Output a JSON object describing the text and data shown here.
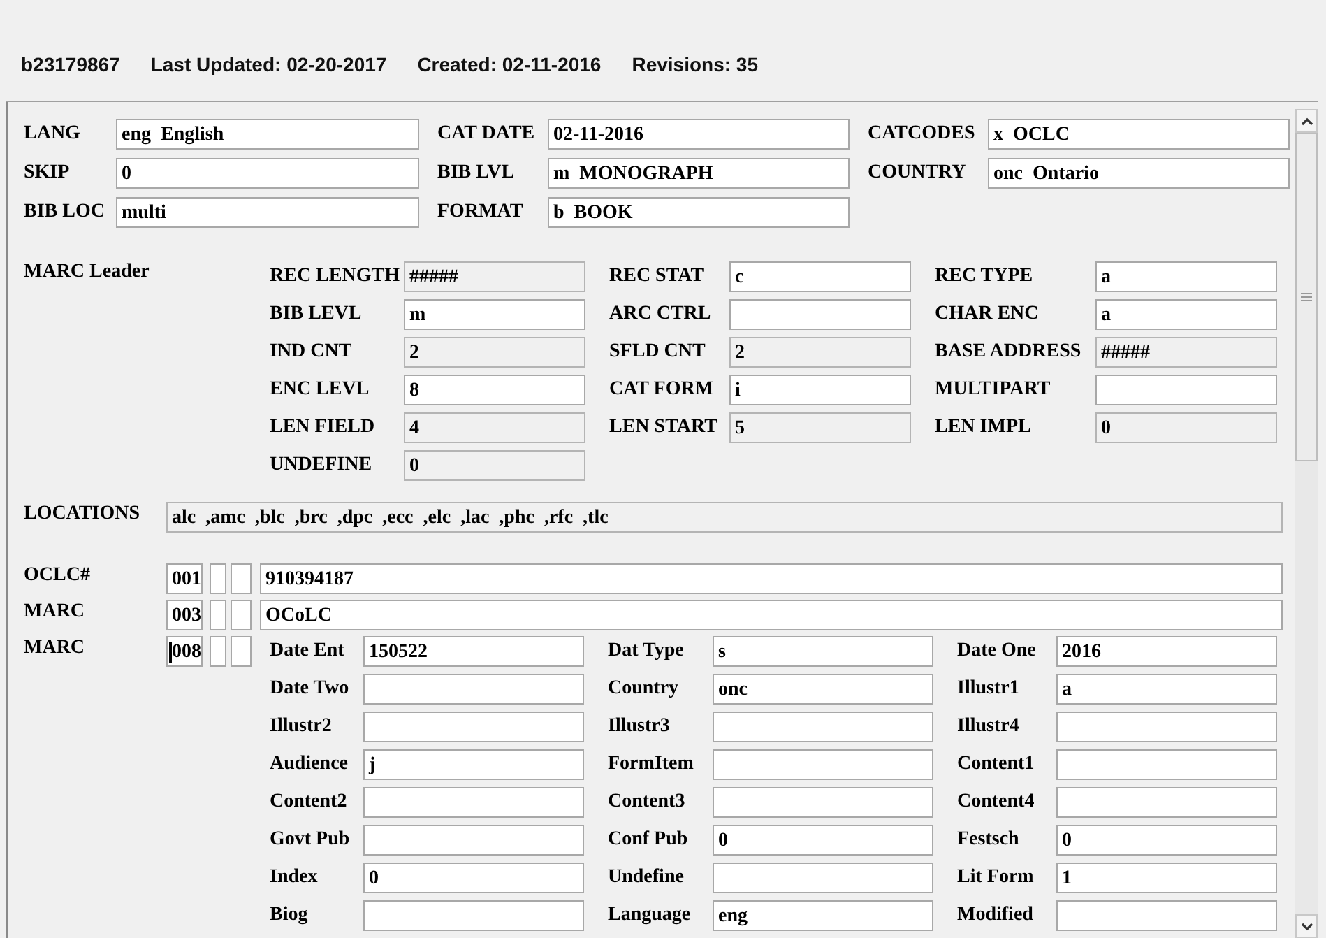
{
  "header": {
    "record_id": "b23179867",
    "last_updated": "Last Updated: 02-20-2017",
    "created": "Created: 02-11-2016",
    "revisions": "Revisions: 35"
  },
  "fixed_fields": [
    {
      "label": "LANG",
      "value": "eng  English"
    },
    {
      "label": "CAT DATE",
      "value": "02-11-2016"
    },
    {
      "label": "CATCODES",
      "value": "x  OCLC"
    },
    {
      "label": "SKIP",
      "value": "0"
    },
    {
      "label": "BIB LVL",
      "value": "m  MONOGRAPH"
    },
    {
      "label": "COUNTRY",
      "value": "onc  Ontario"
    },
    {
      "label": "BIB LOC",
      "value": "multi"
    },
    {
      "label": "FORMAT",
      "value": "b  BOOK"
    }
  ],
  "marc_leader": {
    "title": "MARC Leader",
    "fields": [
      {
        "label": "REC LENGTH",
        "value": "#####",
        "readonly": true
      },
      {
        "label": "REC STAT",
        "value": "c",
        "readonly": false
      },
      {
        "label": "REC TYPE",
        "value": "a",
        "readonly": false
      },
      {
        "label": "BIB LEVL",
        "value": "m",
        "readonly": false
      },
      {
        "label": "ARC CTRL",
        "readonly": false
      },
      {
        "label": "CHAR ENC",
        "value": "a",
        "readonly": false
      },
      {
        "label": "IND CNT",
        "value": "2",
        "readonly": true
      },
      {
        "label": "SFLD CNT",
        "value": "2",
        "readonly": true
      },
      {
        "label": "BASE ADDRESS",
        "value": "#####",
        "readonly": true
      },
      {
        "label": "ENC LEVL",
        "value": "8",
        "readonly": false
      },
      {
        "label": "CAT FORM",
        "value": "i",
        "readonly": false
      },
      {
        "label": "MULTIPART",
        "readonly": false
      },
      {
        "label": "LEN FIELD",
        "value": "4",
        "readonly": true
      },
      {
        "label": "LEN START",
        "value": "5",
        "readonly": true
      },
      {
        "label": "LEN IMPL",
        "value": "0",
        "readonly": true
      },
      {
        "label": "UNDEFINE",
        "value": "0",
        "readonly": true
      }
    ]
  },
  "locations": {
    "label": "LOCATIONS",
    "value": "alc  ,amc  ,blc  ,brc  ,dpc  ,ecc  ,elc  ,lac  ,phc  ,rfc  ,tlc"
  },
  "variable_fields": [
    {
      "kind": "text",
      "label": "OCLC#",
      "tag": "001",
      "focused": false,
      "value": "910394187"
    },
    {
      "kind": "text",
      "label": "MARC",
      "tag": "003",
      "focused": false,
      "value": "OCoLC"
    },
    {
      "kind": "fixed",
      "label": "MARC",
      "tag": "008",
      "focused": true,
      "subfields": [
        {
          "label": "Date Ent",
          "value": "150522"
        },
        {
          "label": "Dat Type",
          "value": "s"
        },
        {
          "label": "Date One",
          "value": "2016"
        },
        {
          "label": "Date Two"
        },
        {
          "label": "Country",
          "value": "onc"
        },
        {
          "label": "Illustr1",
          "value": "a"
        },
        {
          "label": "Illustr2"
        },
        {
          "label": "Illustr3"
        },
        {
          "label": "Illustr4"
        },
        {
          "label": "Audience",
          "value": "j"
        },
        {
          "label": "FormItem"
        },
        {
          "label": "Content1"
        },
        {
          "label": "Content2"
        },
        {
          "label": "Content3"
        },
        {
          "label": "Content4"
        },
        {
          "label": "Govt Pub"
        },
        {
          "label": "Conf Pub",
          "value": "0"
        },
        {
          "label": "Festsch",
          "value": "0"
        },
        {
          "label": "Index",
          "value": "0"
        },
        {
          "label": "Undefine"
        },
        {
          "label": "Lit Form",
          "value": "1"
        },
        {
          "label": "Biog"
        },
        {
          "label": "Language",
          "value": "eng"
        },
        {
          "label": "Modified"
        }
      ]
    }
  ]
}
